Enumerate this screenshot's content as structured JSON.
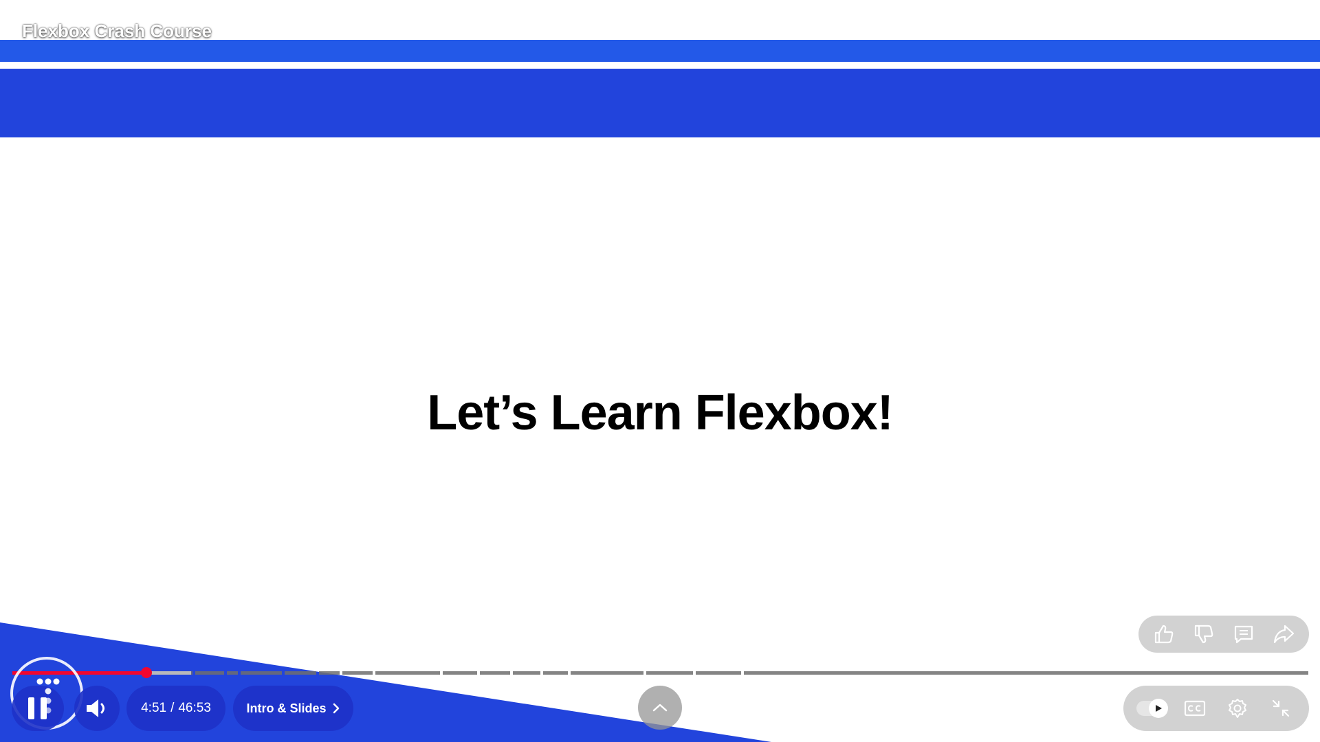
{
  "video": {
    "title": "Flexbox Crash Course"
  },
  "slide": {
    "heading": "Let’s Learn Flexbox!"
  },
  "progress": {
    "current_time": "4:51",
    "separator": "/",
    "duration": "46:53",
    "played_fraction": 0.1034,
    "buffered_fraction": 0.138,
    "played_color": "#f1062f"
  },
  "chapter": {
    "label": "Intro & Slides"
  },
  "colors": {
    "slide_accent_light": "#2359e8",
    "slide_accent_dark": "#2244dc",
    "control_pill": "#1e32c8"
  },
  "controls": {
    "play_state_icon": "pause-icon",
    "volume_icon": "volume-icon",
    "expand_icon": "chevron-up-icon",
    "actions": [
      "like-icon",
      "dislike-icon",
      "comments-icon",
      "share-icon"
    ],
    "settings": [
      "autoplay-toggle",
      "captions-icon",
      "settings-gear-icon",
      "exit-fullscreen-icon"
    ]
  }
}
